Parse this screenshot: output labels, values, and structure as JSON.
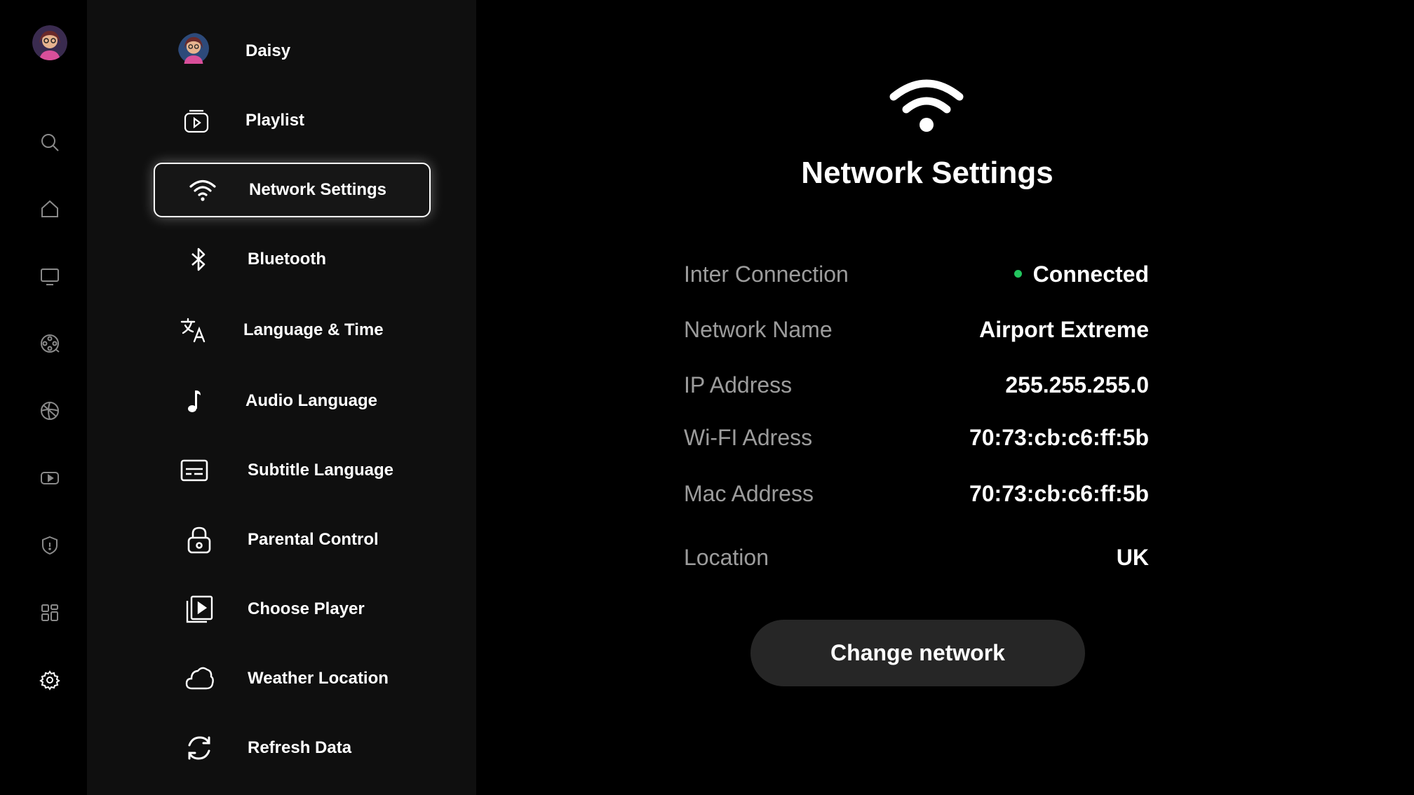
{
  "user": {
    "name": "Daisy"
  },
  "rail": {
    "items": [
      {
        "icon": "search-icon"
      },
      {
        "icon": "home-icon"
      },
      {
        "icon": "tv-icon"
      },
      {
        "icon": "film-reel-icon"
      },
      {
        "icon": "sports-ball-icon"
      },
      {
        "icon": "video-play-icon"
      },
      {
        "icon": "shield-icon"
      },
      {
        "icon": "grid-apps-icon"
      },
      {
        "icon": "gear-icon"
      }
    ]
  },
  "menu": {
    "items": [
      {
        "label": "Daisy",
        "icon": "avatar"
      },
      {
        "label": "Playlist",
        "icon": "playlist-icon"
      },
      {
        "label": "Network Settings",
        "icon": "wifi-icon",
        "active": true
      },
      {
        "label": "Bluetooth",
        "icon": "bluetooth-icon"
      },
      {
        "label": "Language & Time",
        "icon": "translate-icon"
      },
      {
        "label": "Audio Language",
        "icon": "music-note-icon"
      },
      {
        "label": "Subtitle Language",
        "icon": "subtitles-icon"
      },
      {
        "label": "Parental Control",
        "icon": "lock-icon"
      },
      {
        "label": "Choose Player",
        "icon": "player-icon"
      },
      {
        "label": "Weather Location",
        "icon": "cloud-icon"
      },
      {
        "label": "Refresh Data",
        "icon": "refresh-icon"
      }
    ]
  },
  "main": {
    "title": "Network Settings",
    "rows": [
      {
        "label": "Inter Connection",
        "value": "Connected",
        "status_color": "#22c55e"
      },
      {
        "label": "Network Name",
        "value": "Airport Extreme"
      },
      {
        "label": "IP Address",
        "value": "255.255.255.0"
      },
      {
        "label": "Wi-FI Adress",
        "value": "70:73:cb:c6:ff:5b"
      },
      {
        "label": "Mac Address",
        "value": "70:73:cb:c6:ff:5b"
      },
      {
        "label": "Location",
        "value": "UK"
      }
    ],
    "button_label": "Change network"
  },
  "colors": {
    "accent": "#22c55e",
    "menu_bg": "#0f0f0f",
    "button_bg": "#262626"
  }
}
